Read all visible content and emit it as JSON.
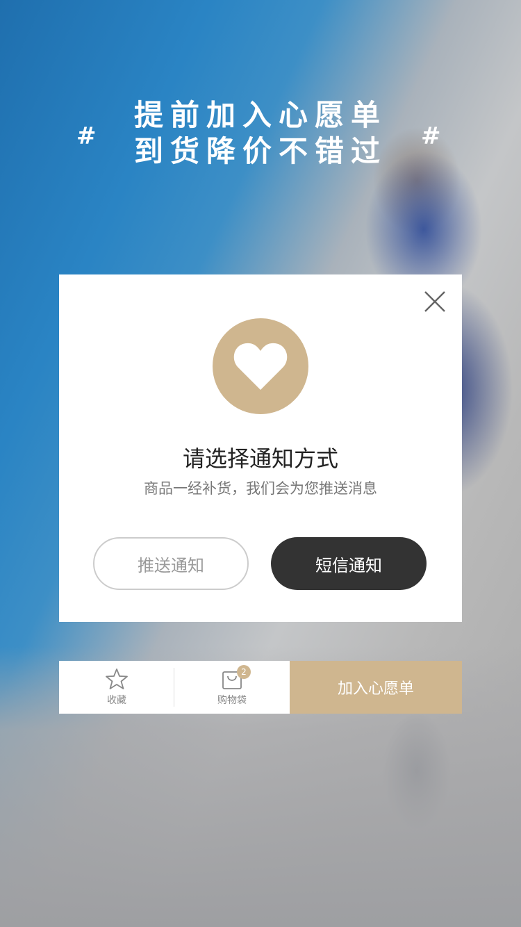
{
  "banner": {
    "line1": "提前加入心愿单",
    "line2": "到货降价不错过",
    "hash_left": "#",
    "hash_right": "#"
  },
  "modal": {
    "title": "请选择通知方式",
    "subtitle": "商品一经补货，我们会为您推送消息",
    "push_button": "推送通知",
    "sms_button": "短信通知",
    "icon": "heart-icon",
    "close_icon": "close-icon"
  },
  "bottom_bar": {
    "favorite_label": "收藏",
    "bag_label": "购物袋",
    "bag_count": "2",
    "wishlist_button": "加入心愿单"
  },
  "colors": {
    "accent_gold": "#cfb68f",
    "dark_button": "#333333"
  }
}
